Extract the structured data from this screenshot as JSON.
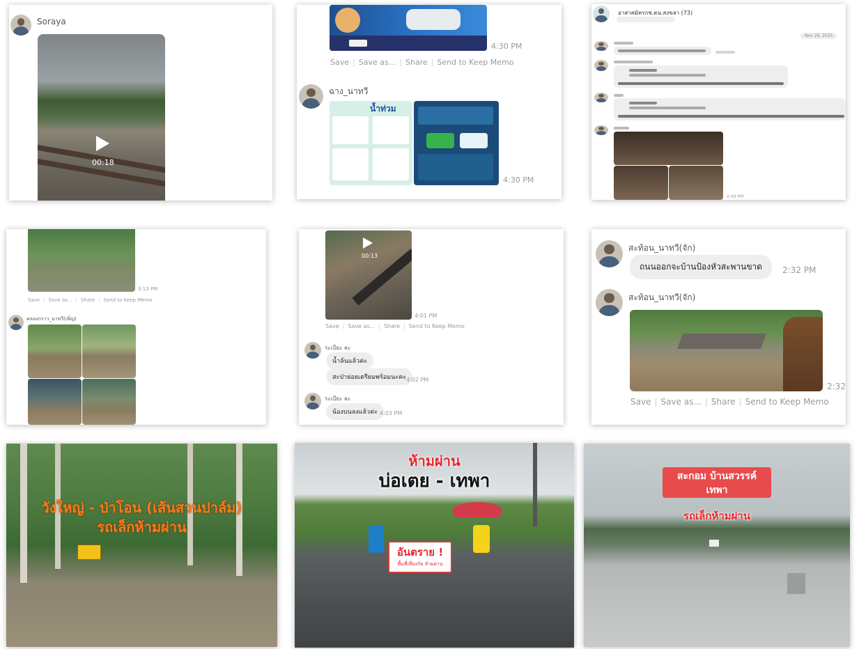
{
  "actions": {
    "save": "Save",
    "save_as": "Save as...",
    "share": "Share",
    "memo": "Send to Keep Memo"
  },
  "p1": {
    "sender": "Soraya",
    "duration": "00:18"
  },
  "p2": {
    "time1": "4:30 PM",
    "sender": "ฉาง_นาทวี",
    "infographic_title": "น้ำท่วม",
    "time2": "4:30 PM"
  },
  "p3": {
    "group": "อาสาสมัครกช.ตน.สงขลา (73)",
    "date": "Nov 26, 2025",
    "time": "2:09 PM"
  },
  "p4": {
    "time": "3:13 PM",
    "sender": "คลองกราว_นาทวี(เพ็ญ)"
  },
  "p5": {
    "duration": "00:13",
    "time1": "4:01 PM",
    "sender1": "ระเบียะ ละ",
    "msg1": "น้ำล้นแล้วค่ะ",
    "msg2": "สะป่าย่อยเตรียมพร้อมนะคะ",
    "time2": "4:02 PM",
    "sender2": "ระเบียะ ละ",
    "msg3": "น้องบนลงแล้วค่ะ",
    "time3": "4:03 PM"
  },
  "p6": {
    "sender1": "สะท้อน_นาทวี(จัก)",
    "msg1": "ถนนออกจะบ้านป้องหัวสะพานขาด",
    "time1": "2:32 PM",
    "sender2": "สะท้อน_นาทวี(จัก)",
    "time2": "2:32"
  },
  "p7": {
    "line1": "วังใหญ่ - ป่าโอน (เส้นสวนปาล์ม)",
    "line2": "รถเล็กห้ามผ่าน"
  },
  "p8": {
    "line1": "ห้ามผ่าน",
    "line2": "บ่อเตย - เทพา",
    "sign_title": "อันตราย !",
    "sign_sub": "พื้นที่เสี่ยงภัย ห้ามผ่าน"
  },
  "p9": {
    "line1": "สะกอม บ้านสวรรค์",
    "line2": "เทพา",
    "line3": "รถเล็กห้ามผ่าน"
  },
  "colors": {
    "orange": "#ff7a1a",
    "red": "#e8262b",
    "banner": "#e84b4b"
  }
}
